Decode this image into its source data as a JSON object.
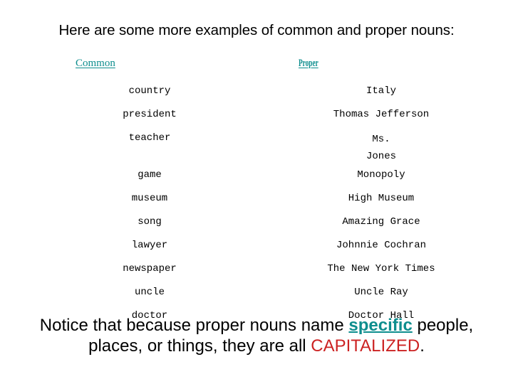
{
  "slide": {
    "title": "Here are some more examples of common and proper nouns:",
    "columns": {
      "common_label": "Common",
      "proper_label": "Proper"
    },
    "rows": [
      {
        "common": "country",
        "proper": "Italy"
      },
      {
        "common": "president",
        "proper": "Thomas Jefferson"
      },
      {
        "common": "teacher",
        "proper": "Ms. Jones"
      },
      {
        "common": "game",
        "proper": "Monopoly"
      },
      {
        "common": "museum",
        "proper": "High Museum"
      },
      {
        "common": "song",
        "proper": "Amazing Grace"
      },
      {
        "common": "lawyer",
        "proper": "Johnnie Cochran"
      },
      {
        "common": "newspaper",
        "proper": "The New York Times"
      },
      {
        "common": "uncle",
        "proper": "Uncle Ray"
      },
      {
        "common": "doctor",
        "proper": "Doctor Hall"
      }
    ],
    "caption": {
      "lead": "Notice that because proper nouns name ",
      "emphasis": "specific",
      "middle": " people, places, or things, they are all ",
      "capitalized": "CAPITALIZED",
      "period": "."
    },
    "colors": {
      "accent_teal": "#0e8e8e",
      "highlight_red": "#cc2222",
      "text_black": "#000000",
      "background": "#ffffff"
    }
  }
}
